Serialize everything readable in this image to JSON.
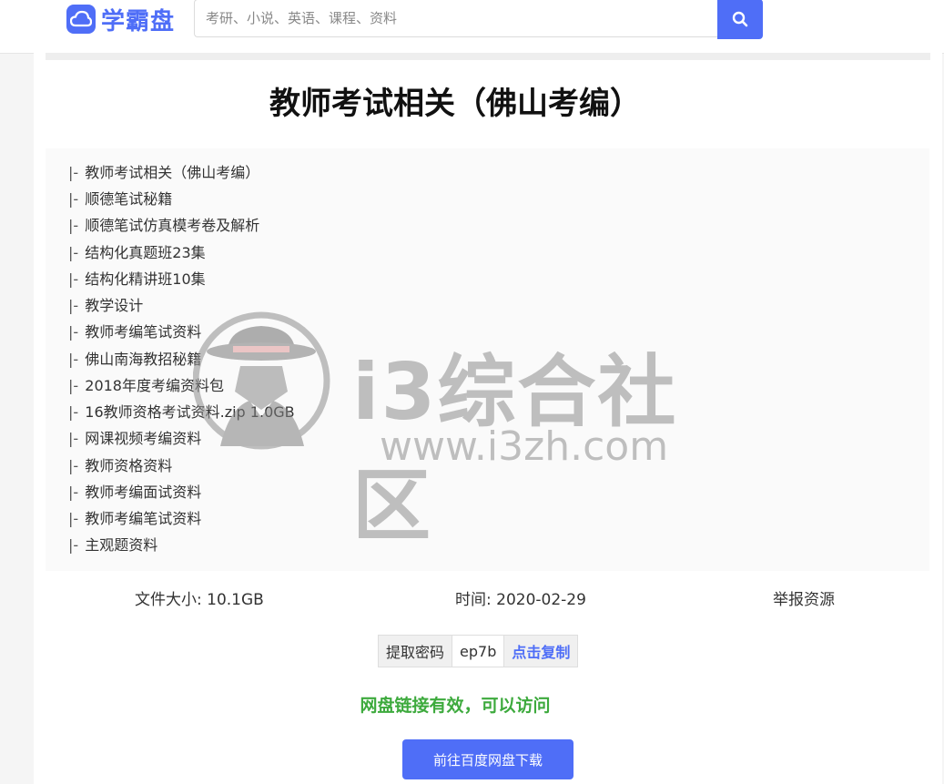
{
  "header": {
    "logo_text": "学霸盘",
    "search_placeholder": "考研、小说、英语、课程、资料"
  },
  "resource": {
    "title": "教师考试相关（佛山考编）",
    "tree_prefix": "|-",
    "files": [
      "教师考试相关（佛山考编）",
      "顺德笔试秘籍",
      "顺德笔试仿真模考卷及解析",
      "结构化真题班23集",
      "结构化精讲班10集",
      "教学设计",
      "教师考编笔试资料",
      "佛山南海教招秘籍",
      "2018年度考编资料包",
      "16教师资格考试资料.zip 1.0GB",
      "网课视频考编资料",
      "教师资格资料",
      "教师考编面试资料",
      "教师考编笔试资料",
      "主观题资料"
    ],
    "size_text": "文件大小: 10.1GB",
    "time_text": "时间: 2020-02-29",
    "report_label": "举报资源",
    "code_label": "提取密码",
    "code_value": "ep7b",
    "copy_label": "点击复制",
    "status_text": "网盘链接有效，可以访问",
    "download_label": "前往百度网盘下载"
  },
  "watermark": {
    "name": "i3综合社区",
    "url": "www.i3zh.com"
  },
  "colors": {
    "accent": "#4f6ef7",
    "status_green": "#3daa3d"
  },
  "icons": [
    "cloud-icon",
    "search-icon",
    "hat-figure-icon"
  ]
}
